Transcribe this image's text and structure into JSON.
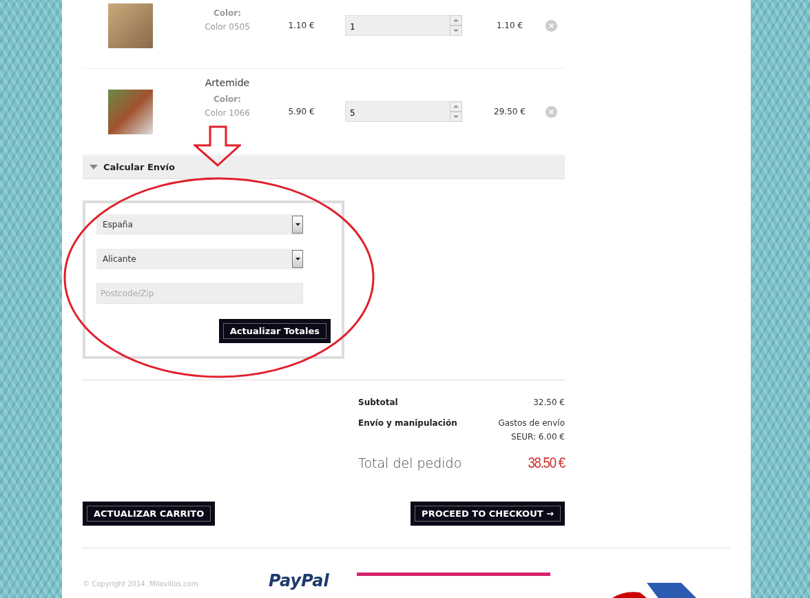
{
  "cart_items": [
    {
      "color_label": "Color:",
      "color_value": "Color 0505",
      "price": "1.10 €",
      "quantity": "1",
      "total": "1.10 €"
    },
    {
      "name": "Artemide",
      "color_label": "Color:",
      "color_value": "Color 1066",
      "price": "5.90 €",
      "quantity": "5",
      "total": "29.50 €"
    }
  ],
  "shipping_calculator": {
    "title": "Calcular Envío",
    "expanded": true,
    "country": "España",
    "province": "Alicante",
    "postcode": {
      "placeholder": "Postcode/Zip"
    },
    "button": "Actualizar Totales"
  },
  "totals": {
    "subtotal_label": "Subtotal",
    "subtotal": "32.50 €",
    "shipping_label": "Envío y manipulación",
    "shipping_lines": [
      "Gastos de envío",
      "SEUR: 6.00 €"
    ],
    "total_label": "Total del pedido",
    "total": "38.50 €"
  },
  "buttons": [
    "ACTUALIZAR CARRITO",
    "PROCEED TO CHECKOUT →"
  ],
  "footer": {
    "copyright": "© Copyright 2014. Milovillos.com",
    "paypal": "PayPal"
  }
}
